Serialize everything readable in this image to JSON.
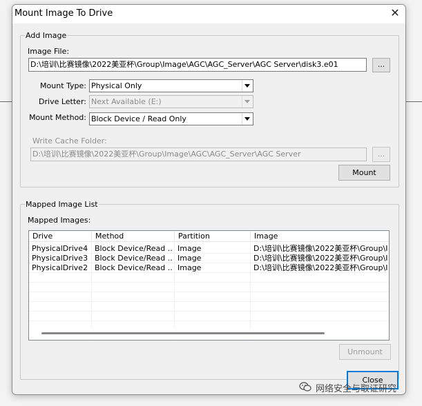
{
  "window": {
    "title": "Mount Image To Drive",
    "close_glyph": "✕"
  },
  "add_image": {
    "legend": "Add Image",
    "image_file_label": "Image File:",
    "image_file_value": "D:\\培训\\比赛镜像\\2022美亚杯\\Group\\Image\\AGC\\AGC_Server\\AGC Server\\disk3.e01",
    "browse_label": "...",
    "mount_type_label": "Mount Type:",
    "mount_type_value": "Physical Only",
    "drive_letter_label": "Drive Letter:",
    "drive_letter_value": "Next Available (E:)",
    "mount_method_label": "Mount Method:",
    "mount_method_value": "Block Device / Read Only",
    "write_cache_label": "Write Cache Folder:",
    "write_cache_value": "D:\\培训\\比赛镜像\\2022美亚杯\\Group\\Image\\AGC\\AGC_Server\\AGC Server",
    "cache_browse_label": "...",
    "mount_button": "Mount"
  },
  "mapped": {
    "legend": "Mapped Image List",
    "list_label": "Mapped Images:",
    "columns": [
      "Drive",
      "Method",
      "Partition",
      "Image"
    ],
    "rows": [
      [
        "PhysicalDrive4",
        "Block Device/Read ...",
        "Image",
        "D:\\培训\\比赛镜像\\2022美亚杯\\Group\\I"
      ],
      [
        "PhysicalDrive3",
        "Block Device/Read ...",
        "Image",
        "D:\\培训\\比赛镜像\\2022美亚杯\\Group\\I"
      ],
      [
        "PhysicalDrive2",
        "Block Device/Read ...",
        "Image",
        "D:\\培训\\比赛镜像\\2022美亚杯\\Group\\I"
      ]
    ],
    "unmount_button": "Unmount"
  },
  "close_button": "Close",
  "watermark": {
    "text": "网络安全与取证研究",
    "icon": "wechat-icon"
  }
}
